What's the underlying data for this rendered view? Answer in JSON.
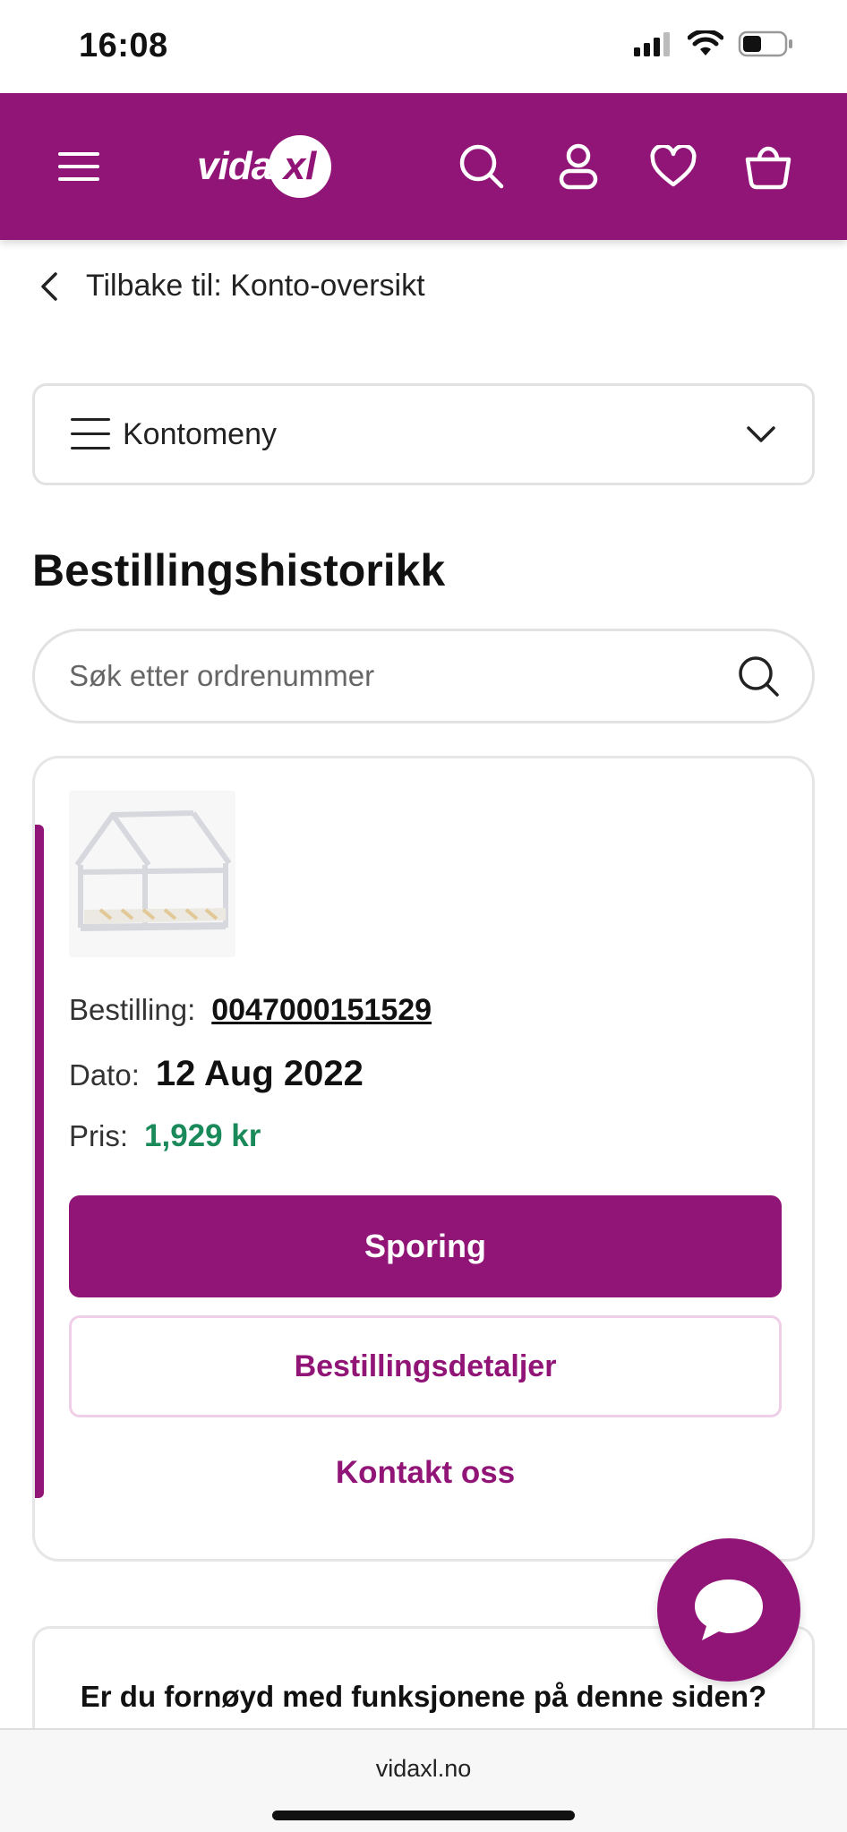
{
  "status_bar": {
    "time": "16:08"
  },
  "header": {
    "logo_text": "vida",
    "logo_xl": "xl",
    "icons": [
      "menu-icon",
      "search-icon",
      "user-icon",
      "heart-icon",
      "basket-icon"
    ],
    "brand_color": "#911477"
  },
  "back_link": {
    "label": "Tilbake til: Konto-oversikt"
  },
  "account_menu": {
    "label": "Kontomeny"
  },
  "page_title": "Bestillingshistorikk",
  "search": {
    "placeholder": "Søk etter ordrenummer"
  },
  "order": {
    "order_label": "Bestilling:",
    "order_number": "0047000151529",
    "date_label": "Dato:",
    "date_value": "12 Aug 2022",
    "price_label": "Pris:",
    "price_value": "1,929 kr",
    "price_color": "#1a8a5a",
    "tracking_button": "Sporing",
    "details_button": "Bestillingsdetaljer",
    "contact_link": "Kontakt oss"
  },
  "feedback": {
    "question": "Er du fornøyd med funksjonene på denne siden?"
  },
  "browser": {
    "url": "vidaxl.no"
  }
}
